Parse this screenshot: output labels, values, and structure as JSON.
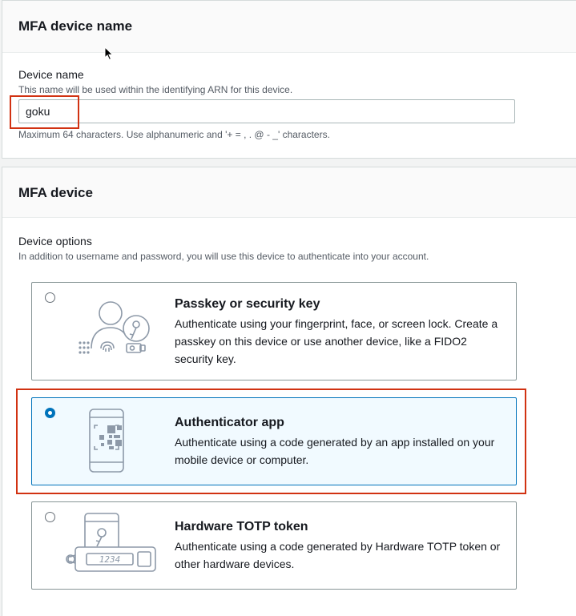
{
  "device_name_section": {
    "title": "MFA device name",
    "field_label": "Device name",
    "field_help": "This name will be used within the identifying ARN for this device.",
    "field_value": "goku",
    "field_constraint": "Maximum 64 characters. Use alphanumeric and '+ = , . @ - _' characters."
  },
  "mfa_device_section": {
    "title": "MFA device",
    "options_label": "Device options",
    "options_help": "In addition to username and password, you will use this device to authenticate into your account.",
    "options": [
      {
        "title": "Passkey or security key",
        "description": "Authenticate using your fingerprint, face, or screen lock. Create a passkey on this device or use another device, like a FIDO2 security key.",
        "icon": "passkey-icon",
        "selected": false
      },
      {
        "title": "Authenticator app",
        "description": "Authenticate using a code generated by an app installed on your mobile device or computer.",
        "icon": "authenticator-app-icon",
        "selected": true
      },
      {
        "title": "Hardware TOTP token",
        "description": "Authenticate using a code generated by Hardware TOTP token or other hardware devices.",
        "icon": "hardware-token-icon",
        "selected": false
      }
    ]
  },
  "token_display_text": "1234",
  "colors": {
    "accent": "#0073bb",
    "highlight": "#d13212",
    "selected_bg": "#f1faff"
  }
}
